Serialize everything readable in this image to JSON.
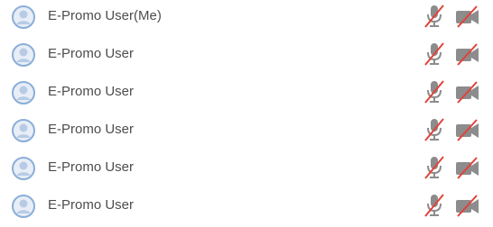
{
  "participants": [
    {
      "name": "E-Promo User(Me)",
      "mic_muted": true,
      "camera_off": true
    },
    {
      "name": "E-Promo User",
      "mic_muted": true,
      "camera_off": true
    },
    {
      "name": "E-Promo User",
      "mic_muted": true,
      "camera_off": true
    },
    {
      "name": "E-Promo User",
      "mic_muted": true,
      "camera_off": true
    },
    {
      "name": "E-Promo User",
      "mic_muted": true,
      "camera_off": true
    },
    {
      "name": "E-Promo User",
      "mic_muted": true,
      "camera_off": true
    }
  ],
  "icons": {
    "avatar": "user-avatar-icon",
    "mic": "microphone-muted-icon",
    "camera": "video-camera-off-icon"
  },
  "colors": {
    "avatar_ring": "#8aaed8",
    "avatar_fill": "#e8eef6",
    "name_text": "#4d4d4d",
    "icon_gray": "#8c8c8c",
    "slash_red": "#e0433a"
  }
}
